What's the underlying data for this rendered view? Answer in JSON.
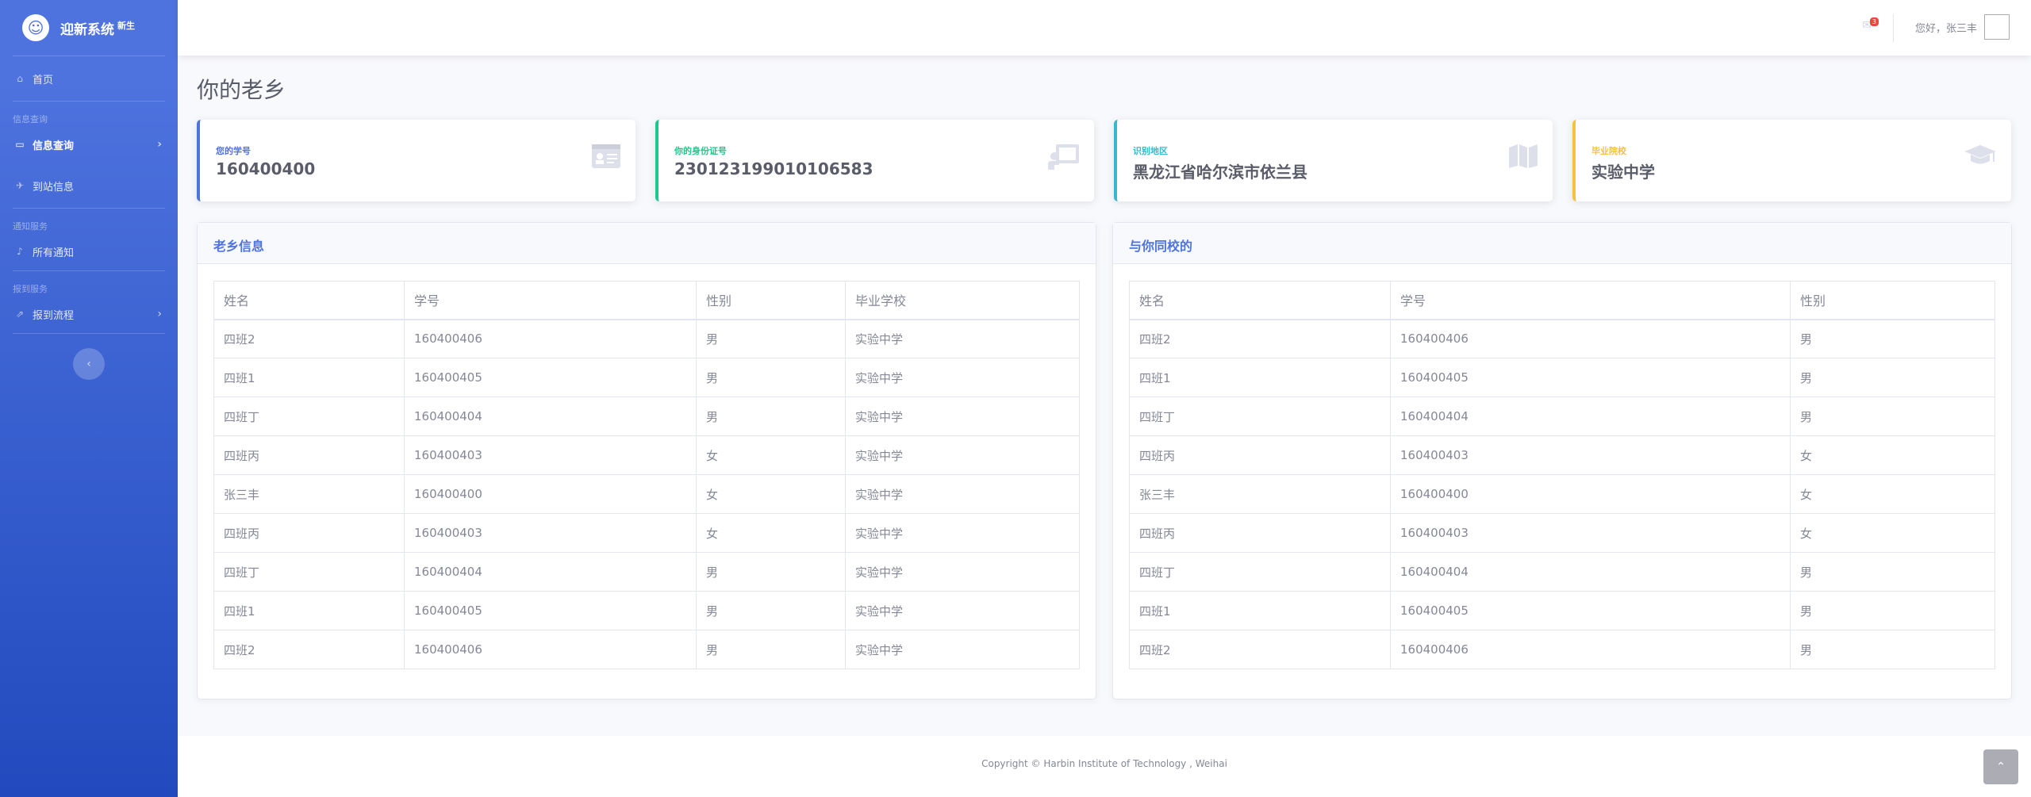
{
  "brand": {
    "name": "迎新系统",
    "sup": "新生"
  },
  "sidebar": {
    "home": "首页",
    "heading1": "信息查询",
    "info_query": "信息查询",
    "arrival": "到站信息",
    "heading2": "通知服务",
    "notices": "所有通知",
    "heading3": "报到服务",
    "process": "报到流程"
  },
  "topbar": {
    "alert_count": "3",
    "greeting": "您好，张三丰"
  },
  "page": {
    "title": "你的老乡"
  },
  "cards": [
    {
      "label": "您的学号",
      "value": "160400400",
      "color": "#4e73df"
    },
    {
      "label": "你的身份证号",
      "value": "230123199010106583",
      "color": "#1cc88a"
    },
    {
      "label": "识别地区",
      "value": "黑龙江省哈尔滨市依兰县",
      "color": "#36b9cc"
    },
    {
      "label": "毕业院校",
      "value": "实验中学",
      "color": "#f6c23e"
    }
  ],
  "left_panel": {
    "title": "老乡信息",
    "headers": [
      "姓名",
      "学号",
      "性别",
      "毕业学校"
    ],
    "rows": [
      [
        "四班2",
        "160400406",
        "男",
        "实验中学"
      ],
      [
        "四班1",
        "160400405",
        "男",
        "实验中学"
      ],
      [
        "四班丁",
        "160400404",
        "男",
        "实验中学"
      ],
      [
        "四班丙",
        "160400403",
        "女",
        "实验中学"
      ],
      [
        "张三丰",
        "160400400",
        "女",
        "实验中学"
      ],
      [
        "四班丙",
        "160400403",
        "女",
        "实验中学"
      ],
      [
        "四班丁",
        "160400404",
        "男",
        "实验中学"
      ],
      [
        "四班1",
        "160400405",
        "男",
        "实验中学"
      ],
      [
        "四班2",
        "160400406",
        "男",
        "实验中学"
      ]
    ]
  },
  "right_panel": {
    "title": "与你同校的",
    "headers": [
      "姓名",
      "学号",
      "性别"
    ],
    "rows": [
      [
        "四班2",
        "160400406",
        "男"
      ],
      [
        "四班1",
        "160400405",
        "男"
      ],
      [
        "四班丁",
        "160400404",
        "男"
      ],
      [
        "四班丙",
        "160400403",
        "女"
      ],
      [
        "张三丰",
        "160400400",
        "女"
      ],
      [
        "四班丙",
        "160400403",
        "女"
      ],
      [
        "四班丁",
        "160400404",
        "男"
      ],
      [
        "四班1",
        "160400405",
        "男"
      ],
      [
        "四班2",
        "160400406",
        "男"
      ]
    ]
  },
  "footer": {
    "text": "Copyright © Harbin Institute of Technology , Weihai"
  }
}
